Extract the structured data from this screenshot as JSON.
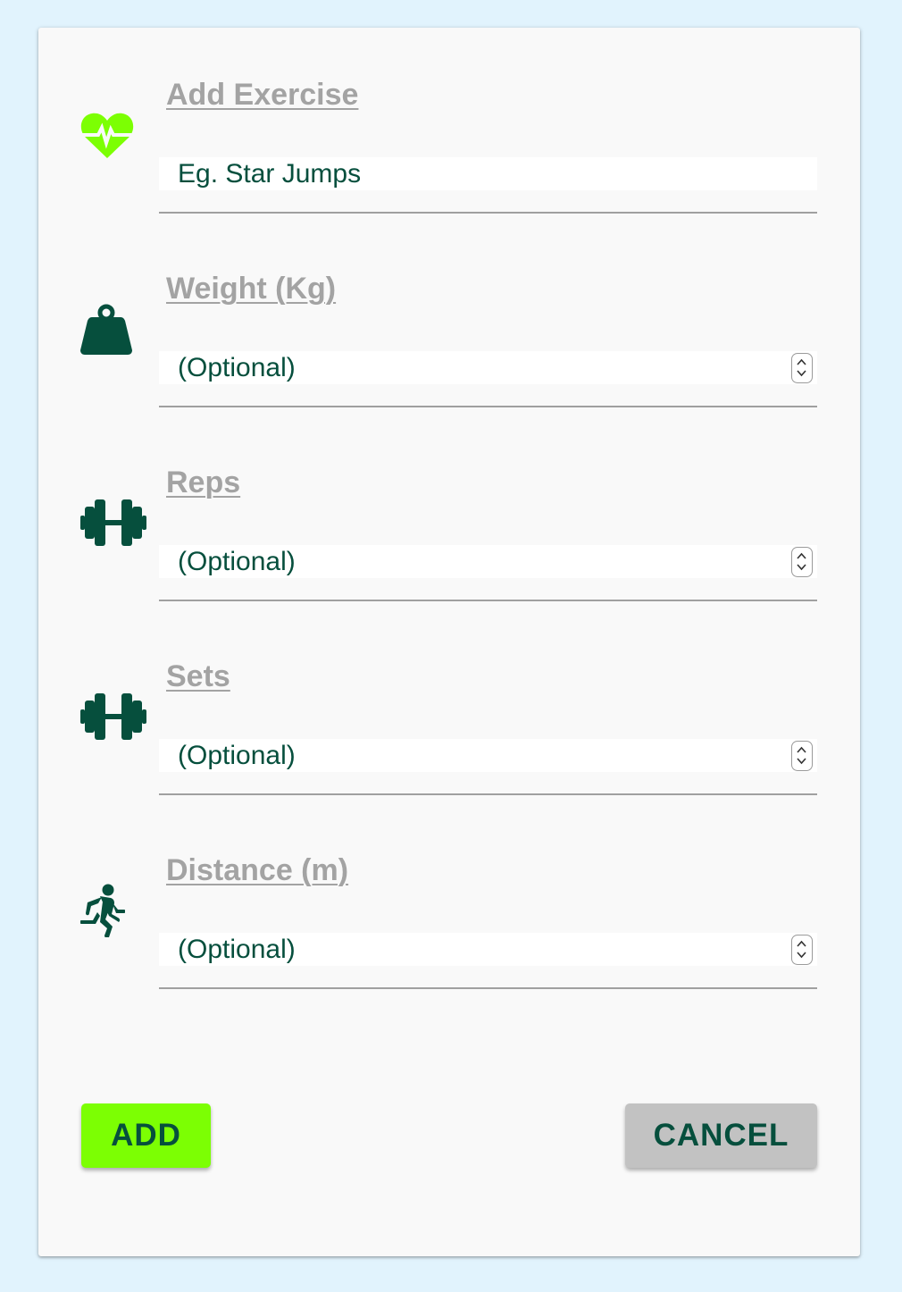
{
  "colors": {
    "page_background": "#e1f3fd",
    "card_background": "#f9f9f9",
    "accent_green": "#7cff03",
    "dark_green": "#064f3d",
    "label_gray": "#a3a3a3",
    "cancel_gray": "#c2c2c2"
  },
  "form": {
    "exercise": {
      "label": "Add Exercise",
      "placeholder": "Eg. Star Jumps",
      "icon": "heartbeat-icon"
    },
    "weight": {
      "label": "Weight (Kg)",
      "placeholder": "(Optional)",
      "icon": "weight-icon"
    },
    "reps": {
      "label": "Reps",
      "placeholder": "(Optional)",
      "icon": "dumbbell-icon"
    },
    "sets": {
      "label": "Sets",
      "placeholder": "(Optional)",
      "icon": "dumbbell-icon"
    },
    "distance": {
      "label": "Distance (m)",
      "placeholder": "(Optional)",
      "icon": "running-icon"
    }
  },
  "actions": {
    "add_label": "ADD",
    "cancel_label": "CANCEL"
  }
}
